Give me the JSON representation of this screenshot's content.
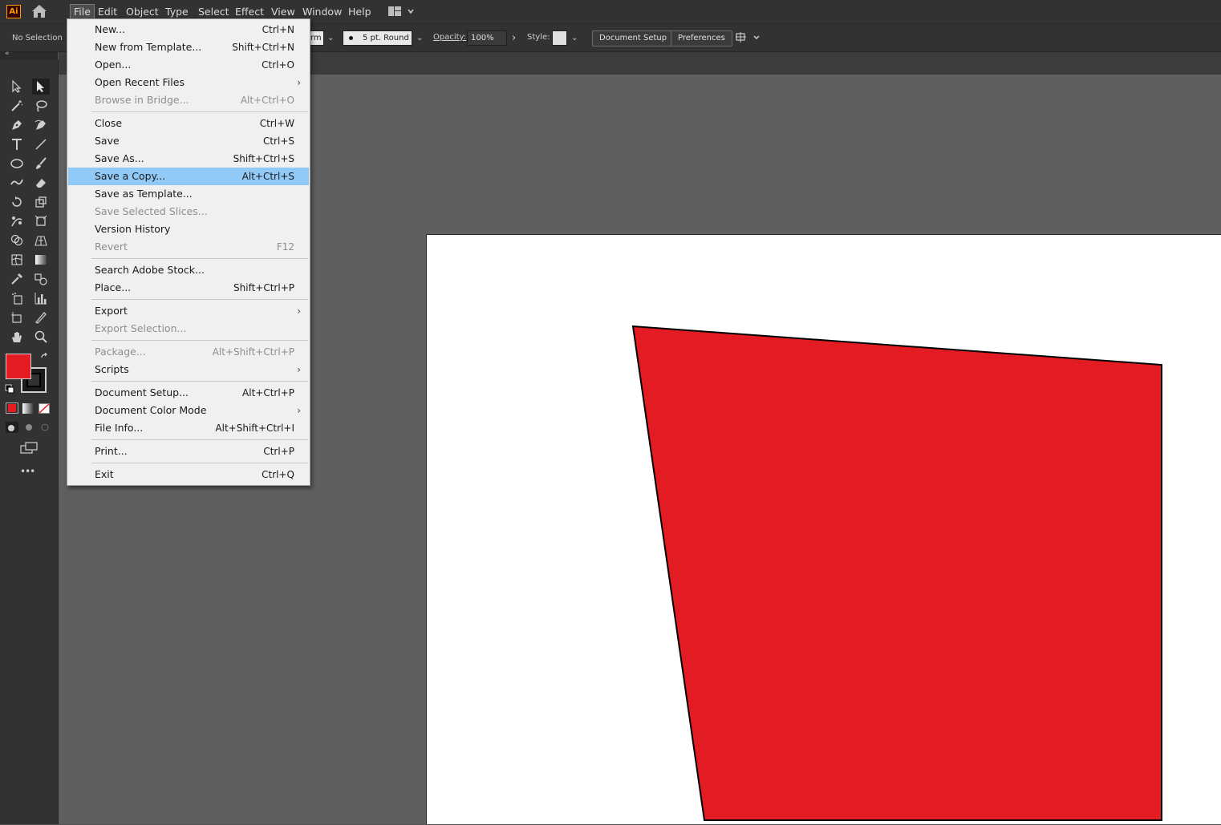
{
  "app": {
    "logo_text": "Ai"
  },
  "menubar": {
    "items": [
      "File",
      "Edit",
      "Object",
      "Type",
      "Select",
      "Effect",
      "View",
      "Window",
      "Help"
    ],
    "active": "File"
  },
  "controlbar": {
    "selection_status": "No Selection",
    "stroke_profile_partial": "rm",
    "brush": "5 pt. Round",
    "opacity_label": "Opacity:",
    "opacity_value": "100%",
    "style_label": "Style:",
    "document_setup": "Document Setup",
    "preferences": "Preferences"
  },
  "file_menu": {
    "items": [
      {
        "label": "New...",
        "shortcut": "Ctrl+N",
        "enabled": true
      },
      {
        "label": "New from Template...",
        "shortcut": "Shift+Ctrl+N",
        "enabled": true
      },
      {
        "label": "Open...",
        "shortcut": "Ctrl+O",
        "enabled": true
      },
      {
        "label": "Open Recent Files",
        "shortcut": "",
        "submenu": true,
        "enabled": true
      },
      {
        "label": "Browse in Bridge...",
        "shortcut": "Alt+Ctrl+O",
        "enabled": false
      },
      {
        "label": "Close",
        "shortcut": "Ctrl+W",
        "enabled": true
      },
      {
        "label": "Save",
        "shortcut": "Ctrl+S",
        "enabled": true
      },
      {
        "label": "Save As...",
        "shortcut": "Shift+Ctrl+S",
        "enabled": true
      },
      {
        "label": "Save a Copy...",
        "shortcut": "Alt+Ctrl+S",
        "enabled": true,
        "highlighted": true
      },
      {
        "label": "Save as Template...",
        "shortcut": "",
        "enabled": true
      },
      {
        "label": "Save Selected Slices...",
        "shortcut": "",
        "enabled": false
      },
      {
        "label": "Version History",
        "shortcut": "",
        "enabled": true
      },
      {
        "label": "Revert",
        "shortcut": "F12",
        "enabled": false
      },
      {
        "label": "Search Adobe Stock...",
        "shortcut": "",
        "enabled": true
      },
      {
        "label": "Place...",
        "shortcut": "Shift+Ctrl+P",
        "enabled": true
      },
      {
        "label": "Export",
        "shortcut": "",
        "submenu": true,
        "enabled": true
      },
      {
        "label": "Export Selection...",
        "shortcut": "",
        "enabled": false
      },
      {
        "label": "Package...",
        "shortcut": "Alt+Shift+Ctrl+P",
        "enabled": false
      },
      {
        "label": "Scripts",
        "shortcut": "",
        "submenu": true,
        "enabled": true
      },
      {
        "label": "Document Setup...",
        "shortcut": "Alt+Ctrl+P",
        "enabled": true
      },
      {
        "label": "Document Color Mode",
        "shortcut": "",
        "submenu": true,
        "enabled": true
      },
      {
        "label": "File Info...",
        "shortcut": "Alt+Shift+Ctrl+I",
        "enabled": true
      },
      {
        "label": "Print...",
        "shortcut": "Ctrl+P",
        "enabled": true
      },
      {
        "label": "Exit",
        "shortcut": "Ctrl+Q",
        "enabled": true
      }
    ]
  },
  "colors": {
    "fill": "#e31b22",
    "stroke": "#000000",
    "menu_highlight": "#91c9f7",
    "artboard": "#ffffff"
  },
  "icons": {
    "more_tools": "•••",
    "submenu_arrow": "›"
  }
}
